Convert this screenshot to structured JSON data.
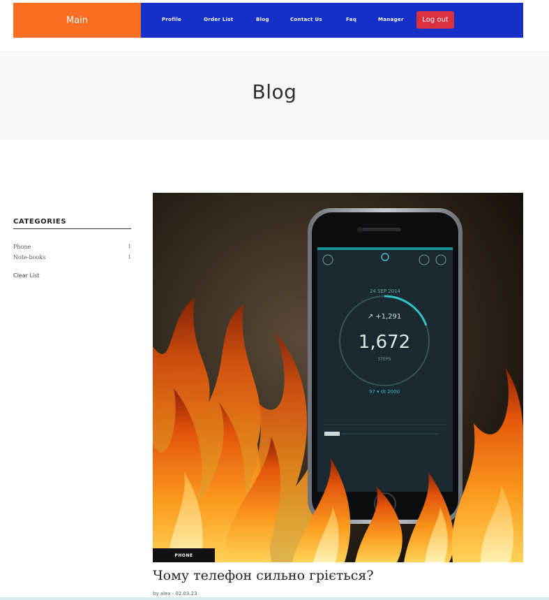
{
  "nav": {
    "main_label": "Main",
    "links": [
      "Profile",
      "Order List",
      "Blog",
      "Contact Us",
      "Faq",
      "Manager"
    ],
    "logout_label": "Log out",
    "colors": {
      "main_bg": "#fb6e22",
      "bar_bg": "#1530c7",
      "logout_bg": "#db3040"
    }
  },
  "banner": {
    "title": "Blog"
  },
  "sidebar": {
    "title": "CATEGORIES",
    "categories": [
      {
        "label": "Phone",
        "count": "1"
      },
      {
        "label": "Note-books",
        "count": "1"
      }
    ],
    "clear_label": "Clear List"
  },
  "post": {
    "category": "PHONE",
    "title": "Чому телефон сильно гріється?",
    "meta": "by alex - 02.03.23",
    "screen": {
      "date": "24 SEP 2014",
      "delta": "↗ +1,291",
      "steps_value": "1,672",
      "steps_label": "STEPS",
      "goal": "97 ▾ dt 2000"
    }
  }
}
